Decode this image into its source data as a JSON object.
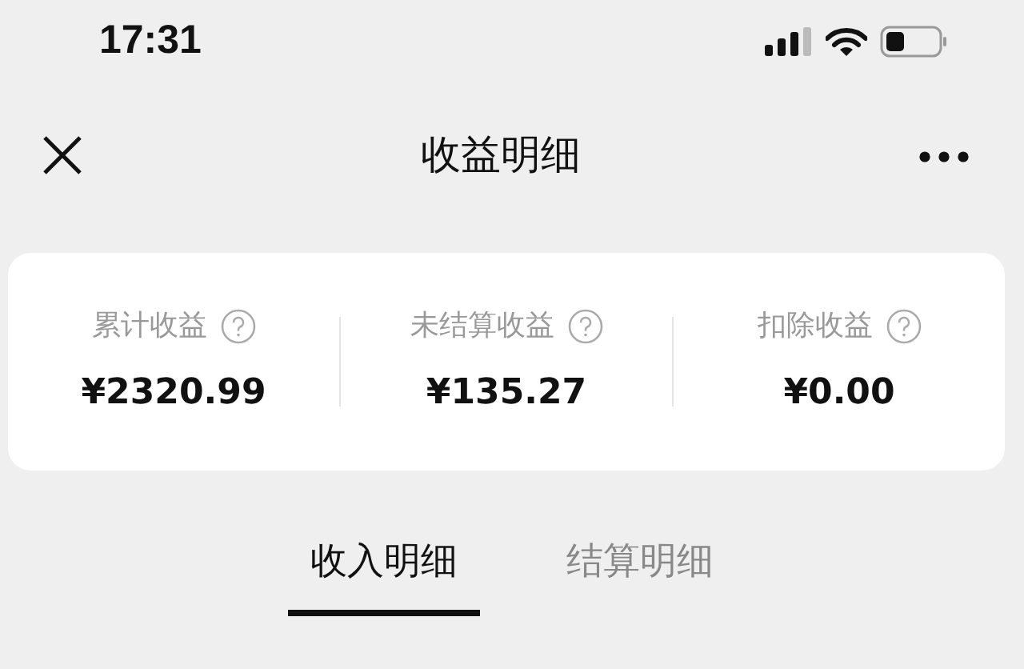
{
  "status_bar": {
    "time": "17:31"
  },
  "nav": {
    "title": "收益明细"
  },
  "summary": [
    {
      "label": "累计收益",
      "value": "¥2320.99"
    },
    {
      "label": "未结算收益",
      "value": "¥135.27"
    },
    {
      "label": "扣除收益",
      "value": "¥0.00"
    }
  ],
  "tabs": [
    {
      "label": "收入明细",
      "selected": true
    },
    {
      "label": "结算明细",
      "selected": false
    }
  ]
}
